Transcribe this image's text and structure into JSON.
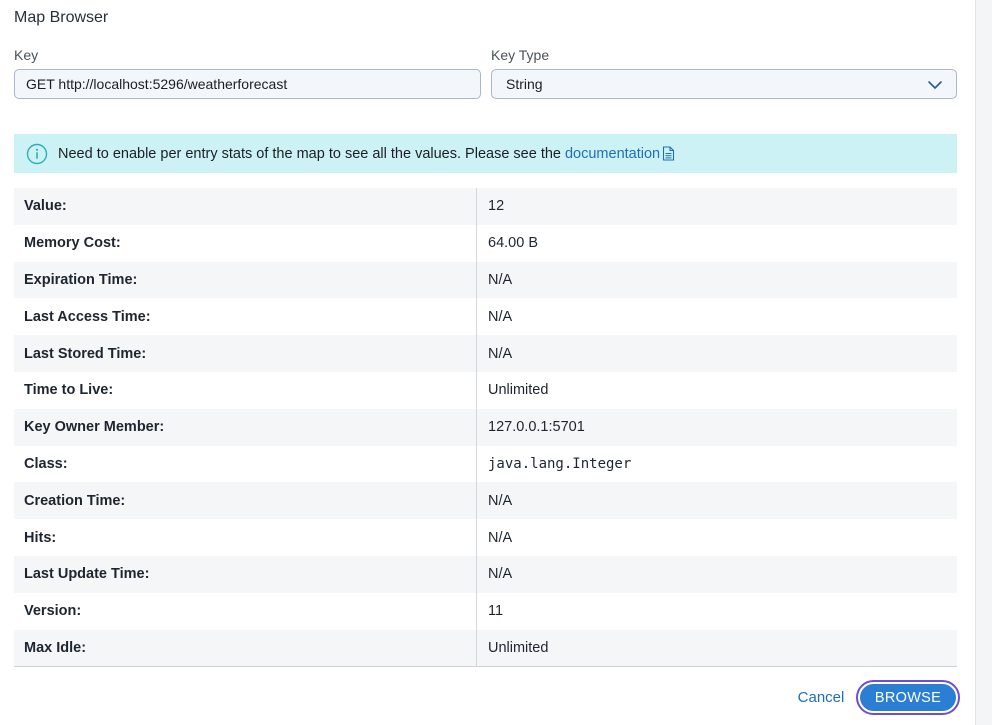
{
  "dialog": {
    "title": "Map Browser"
  },
  "key": {
    "label": "Key",
    "value": "GET http://localhost:5296/weatherforecast"
  },
  "key_type": {
    "label": "Key Type",
    "selected": "String"
  },
  "info": {
    "message": "Need to enable per entry stats of the map to see all the values. Please see the",
    "link_text": "documentation",
    "icon": "info-circle-icon",
    "link_icon": "document-icon"
  },
  "properties": [
    {
      "label": "Value:",
      "value": "12"
    },
    {
      "label": "Memory Cost:",
      "value": "64.00 B"
    },
    {
      "label": "Expiration Time:",
      "value": "N/A"
    },
    {
      "label": "Last Access Time:",
      "value": "N/A"
    },
    {
      "label": "Last Stored Time:",
      "value": "N/A"
    },
    {
      "label": "Time to Live:",
      "value": "Unlimited"
    },
    {
      "label": "Key Owner Member:",
      "value": "127.0.0.1:5701"
    },
    {
      "label": "Class:",
      "value": "java.lang.Integer"
    },
    {
      "label": "Creation Time:",
      "value": "N/A"
    },
    {
      "label": "Hits:",
      "value": "N/A"
    },
    {
      "label": "Last Update Time:",
      "value": "N/A"
    },
    {
      "label": "Version:",
      "value": "11"
    },
    {
      "label": "Max Idle:",
      "value": "Unlimited"
    }
  ],
  "actions": {
    "cancel_label": "Cancel",
    "browse_label": "BROWSE"
  },
  "colors": {
    "accent": "#2a7fd4",
    "focus_ring": "#6f4bd8",
    "info_bg": "#cdf2f5",
    "link": "#1d6fb8"
  }
}
